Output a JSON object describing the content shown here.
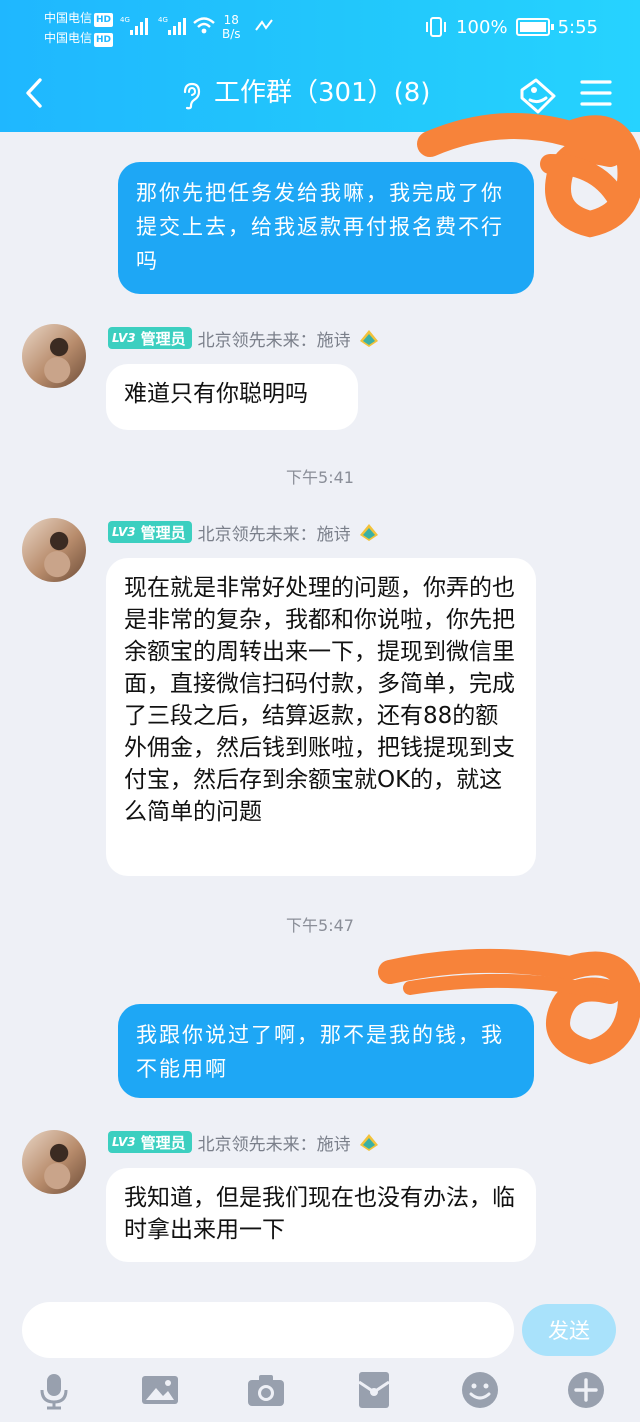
{
  "status_bar": {
    "carrier1": "中国电信",
    "carrier2": "中国电信",
    "hd": "HD",
    "network": "4G",
    "speed_value": "18",
    "speed_unit": "B/s",
    "battery": "100%",
    "time": "5:55"
  },
  "header": {
    "title": "工作群（301）(8)"
  },
  "messages": [
    {
      "side": "out",
      "text": "那你先把任务发给我嘛，我完成了你提交上去，给我返款再付报名费不行吗"
    },
    {
      "side": "in",
      "badge_level": "LV3",
      "badge_role": "管理员",
      "sender": "北京领先未来：施诗",
      "text": "难道只有你聪明吗"
    },
    {
      "time": "下午5:41"
    },
    {
      "side": "in",
      "badge_level": "LV3",
      "badge_role": "管理员",
      "sender": "北京领先未来：施诗",
      "text": "现在就是非常好处理的问题，你弄的也是非常的复杂，我都和你说啦，你先把余额宝的周转出来一下，提现到微信里面，直接微信扫码付款，多简单，完成了三段之后，结算返款，还有88的额外佣金，然后钱到账啦，把钱提现到支付宝，然后存到余额宝就OK的，就这么简单的问题"
    },
    {
      "time": "下午5:47"
    },
    {
      "side": "out",
      "text": "我跟你说过了啊，那不是我的钱，我不能用啊"
    },
    {
      "side": "in",
      "badge_level": "LV3",
      "badge_role": "管理员",
      "sender": "北京领先未来：施诗",
      "text": "我知道，但是我们现在也没有办法，临时拿出来用一下"
    }
  ],
  "input": {
    "placeholder": "",
    "send_label": "发送"
  },
  "colors": {
    "header": "#1fb7ff",
    "outgoing_bubble": "#1ea7f5",
    "badge": "#3ccfc0",
    "scribble": "#f7833a",
    "send_button": "#a9e2fb"
  },
  "icons": [
    "back-arrow-icon",
    "ear-icon",
    "tag-icon",
    "menu-icon",
    "microphone-icon",
    "image-icon",
    "camera-icon",
    "red-packet-icon",
    "emoji-icon",
    "plus-icon"
  ]
}
